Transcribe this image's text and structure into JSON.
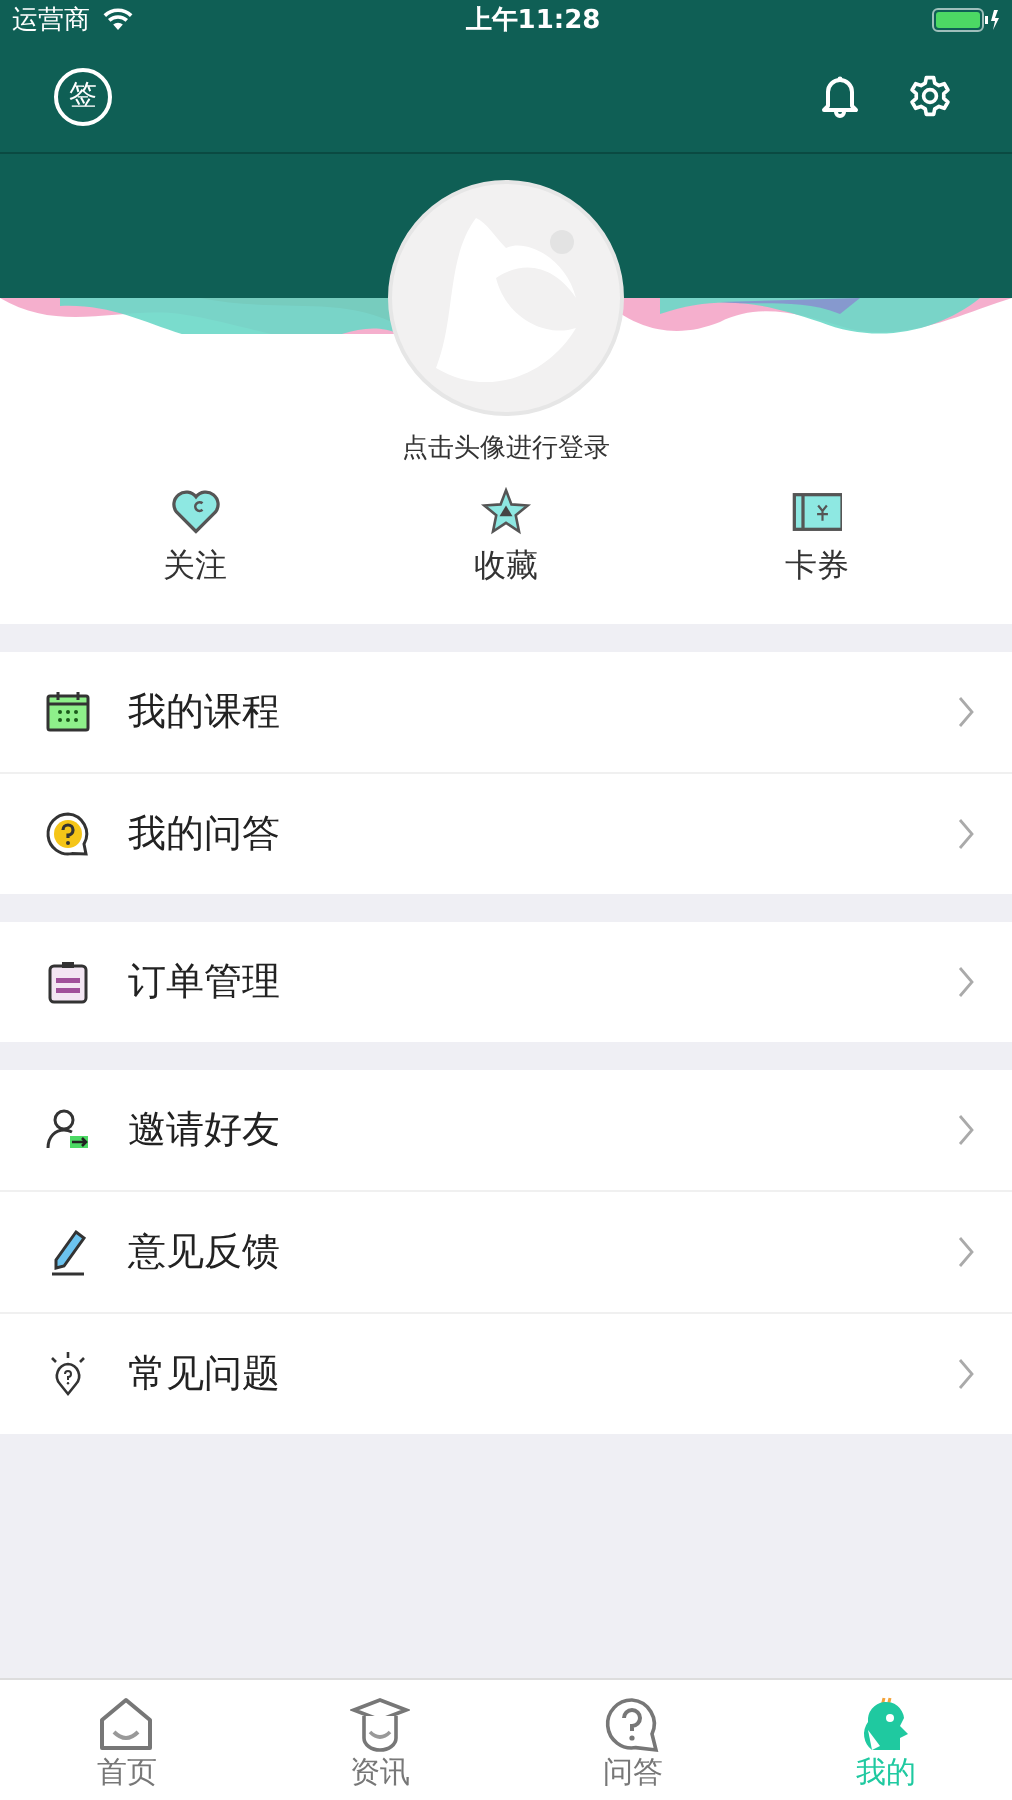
{
  "status_bar": {
    "carrier": "运营商",
    "time": "上午11:28"
  },
  "header": {
    "sign_in_label": "签"
  },
  "profile": {
    "login_prompt": "点击头像进行登录"
  },
  "shortcuts": [
    {
      "kind": "heart",
      "label": "关注"
    },
    {
      "kind": "star",
      "label": "收藏"
    },
    {
      "kind": "ticket",
      "label": "卡券"
    }
  ],
  "menu_groups": [
    [
      {
        "kind": "calendar",
        "label": "我的课程"
      },
      {
        "kind": "question",
        "label": "我的问答"
      }
    ],
    [
      {
        "kind": "clipboard",
        "label": "订单管理"
      }
    ],
    [
      {
        "kind": "invite",
        "label": "邀请好友"
      },
      {
        "kind": "pencil",
        "label": "意见反馈"
      },
      {
        "kind": "bulb",
        "label": "常见问题"
      }
    ]
  ],
  "tab_bar": [
    {
      "kind": "home",
      "label": "首页",
      "selected": false
    },
    {
      "kind": "news",
      "label": "资讯",
      "selected": false
    },
    {
      "kind": "qa",
      "label": "问答",
      "selected": false
    },
    {
      "kind": "me",
      "label": "我的",
      "selected": true
    }
  ]
}
